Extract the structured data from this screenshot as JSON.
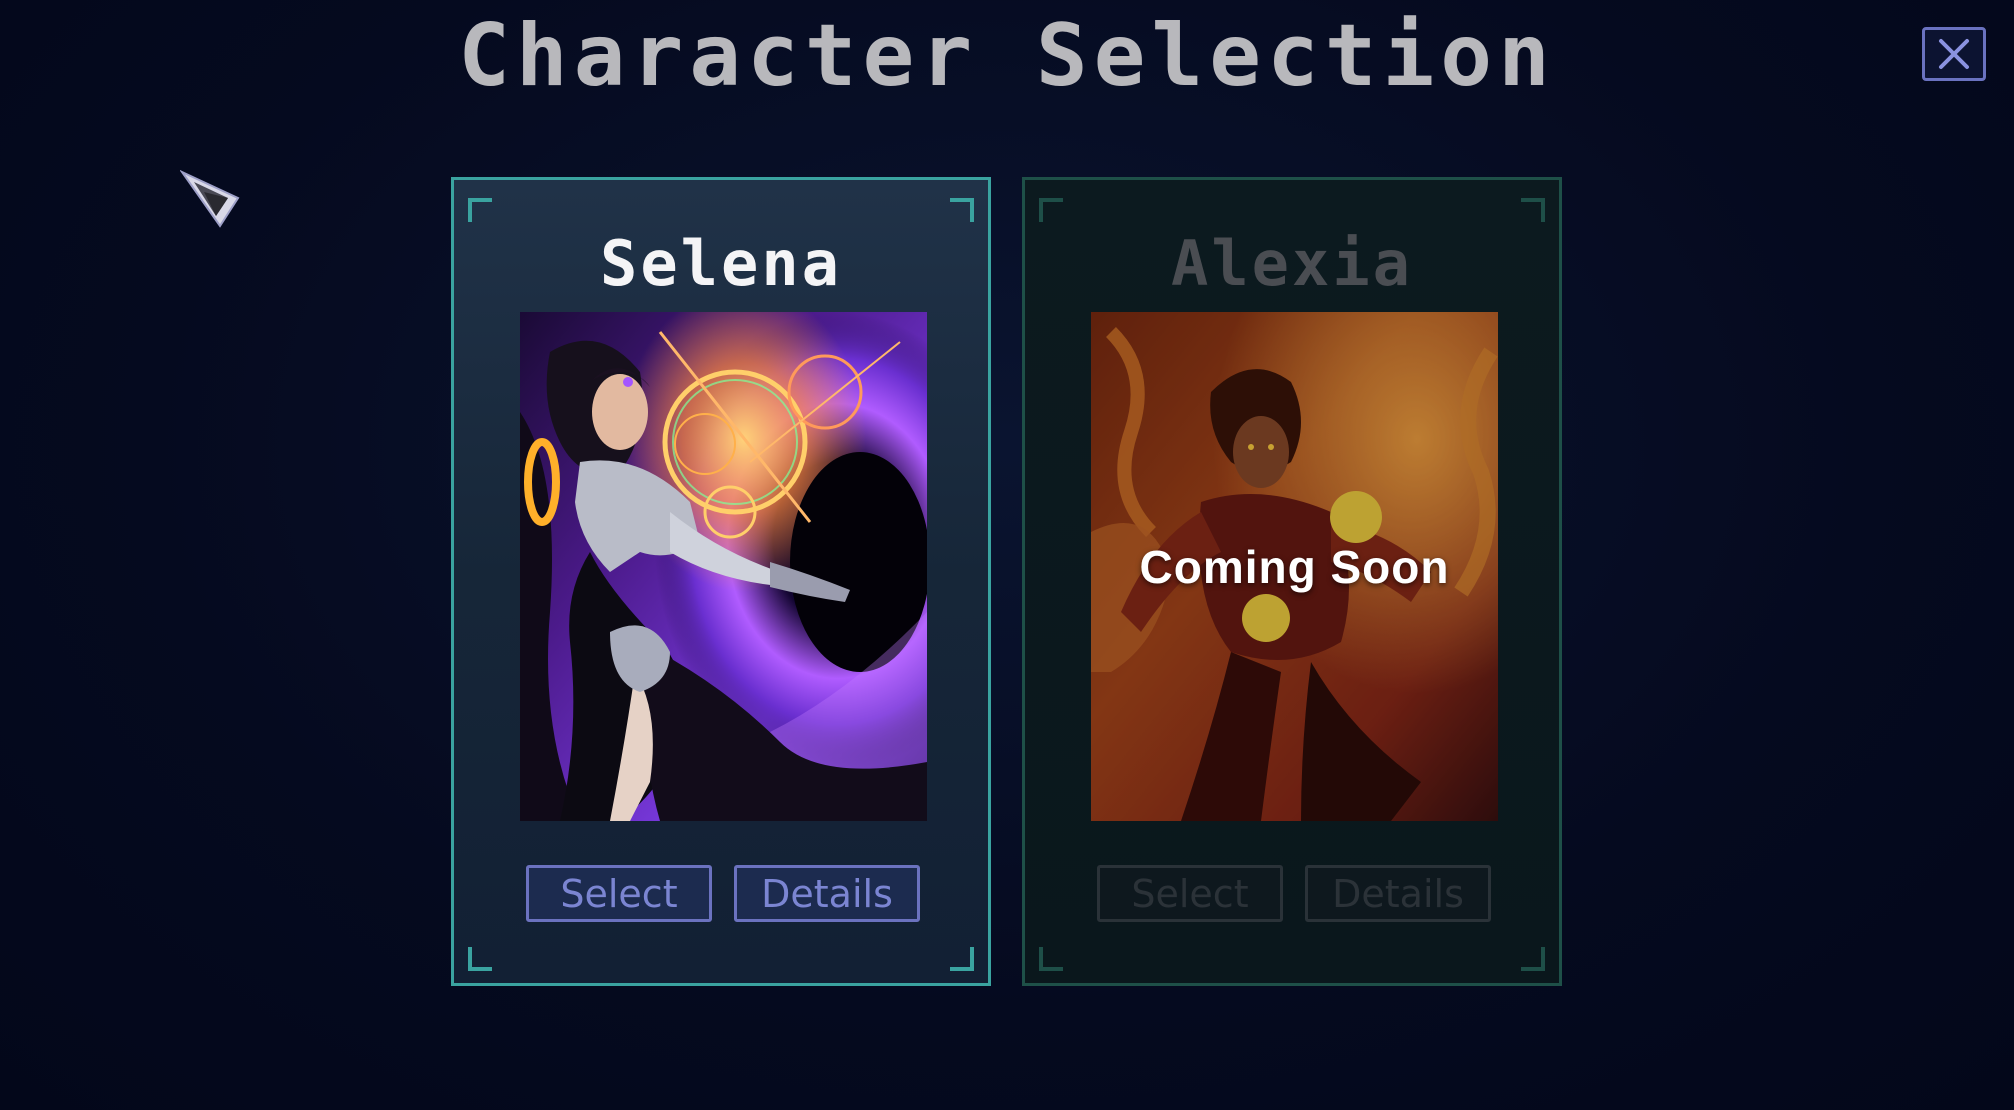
{
  "screen": {
    "title": "Character Selection",
    "close_icon": "close-icon",
    "cursor_icon": "arrow-cursor-icon"
  },
  "characters": [
    {
      "name": "Selena",
      "available": true,
      "portrait_icon": "selena-portrait",
      "overlay_text": "",
      "select_label": "Select",
      "details_label": "Details"
    },
    {
      "name": "Alexia",
      "available": false,
      "portrait_icon": "alexia-portrait",
      "overlay_text": "Coming Soon",
      "select_label": "Select",
      "details_label": "Details"
    }
  ],
  "colors": {
    "background": "#050a1f",
    "card_border_active": "#3aa3a0",
    "card_border_disabled": "#1e5048",
    "button_border": "#6b72bf",
    "button_text": "#7b85d2",
    "title_text": "#b8b8bc"
  }
}
